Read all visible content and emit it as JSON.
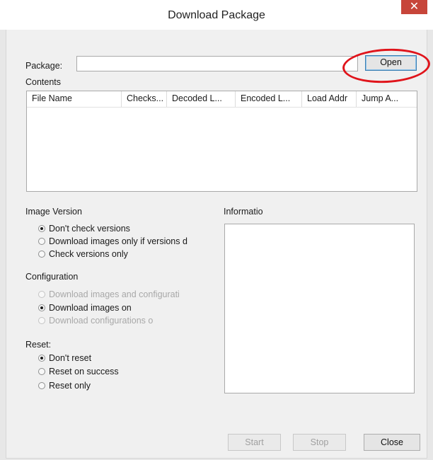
{
  "window": {
    "title": "Download Package",
    "close_glyph": "✕"
  },
  "package": {
    "label": "Package:",
    "value": "",
    "open_button": "Open"
  },
  "contents": {
    "label": "Contents",
    "columns": [
      "File Name",
      "Checks...",
      "Decoded L...",
      "Encoded L...",
      "Load Addr",
      "Jump A..."
    ]
  },
  "image_version": {
    "label": "Image Version",
    "options": [
      {
        "label": "Don't check versions",
        "selected": true,
        "enabled": true
      },
      {
        "label": "Download images only if versions d",
        "selected": false,
        "enabled": true
      },
      {
        "label": "Check versions only",
        "selected": false,
        "enabled": true
      }
    ]
  },
  "configuration": {
    "label": "Configuration",
    "options": [
      {
        "label": "Download images and configurati",
        "selected": false,
        "enabled": false
      },
      {
        "label": "Download images on",
        "selected": true,
        "enabled": true
      },
      {
        "label": "Download configurations o",
        "selected": false,
        "enabled": false
      }
    ]
  },
  "reset": {
    "label": "Reset:",
    "options": [
      {
        "label": "Don't reset",
        "selected": true,
        "enabled": true
      },
      {
        "label": "Reset on success",
        "selected": false,
        "enabled": true
      },
      {
        "label": "Reset only",
        "selected": false,
        "enabled": true
      }
    ]
  },
  "information": {
    "label": "Informatio",
    "text": ""
  },
  "buttons": {
    "start": "Start",
    "stop": "Stop",
    "close": "Close"
  },
  "annotation": {
    "color": "#e0141b"
  }
}
